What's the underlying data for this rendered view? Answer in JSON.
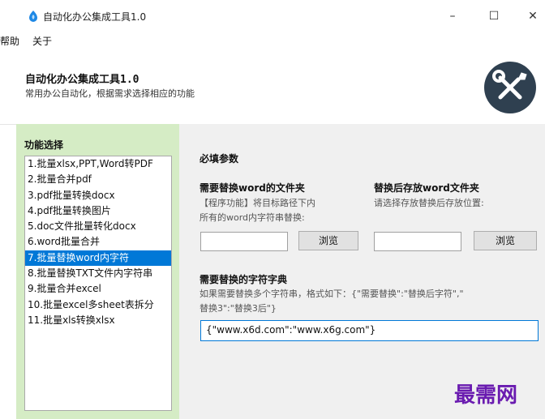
{
  "window": {
    "title": "自动化办公集成工具1.0",
    "minimize": "–",
    "maximize": "☐",
    "close": "✕"
  },
  "menu": [
    "帮助",
    "关于"
  ],
  "header": {
    "title": "自动化办公集成工具1.0",
    "subtitle": "常用办公自动化，根据需求选择相应的功能",
    "logo_icon": "tools-icon"
  },
  "sidebar": {
    "title": "功能选择",
    "selected_index": 6,
    "items": [
      "1.批量xlsx,PPT,Word转PDF",
      "2.批量合并pdf",
      "3.pdf批量转换docx",
      "4.pdf批量转换图片",
      "5.doc文件批量转化docx",
      "6.word批量合并",
      "7.批量替换word内字符",
      "8.批量替换TXT文件内字符串",
      "9.批量合并excel",
      "10.批量excel多sheet表拆分",
      "11.批量xls转换xlsx"
    ]
  },
  "main": {
    "section_title": "必填参数",
    "source": {
      "label": "需要替换word的文件夹",
      "hint1": "【程序功能】将目标路径下内",
      "hint2": "所有的word内字符串替换:",
      "value": "",
      "browse": "浏览"
    },
    "target": {
      "label": "替换后存放word文件夹",
      "hint": "请选择存放替换后存放位置:",
      "value": "",
      "browse": "浏览"
    },
    "dict": {
      "label": "需要替换的字符字典",
      "hint1": "如果需要替换多个字符串，格式如下：{\"需要替换\":\"替换后字符\",\"",
      "hint2": "替换3\":\"替换3后\"}",
      "value": "{\"www.x6d.com\":\"www.x6g.com\"}"
    }
  },
  "watermark": "最需网",
  "colors": {
    "sidebar_bg": "#d5ecc5",
    "selected": "#0078d7",
    "watermark": "#6a1bb0",
    "logo_bg": "#2f4050"
  }
}
